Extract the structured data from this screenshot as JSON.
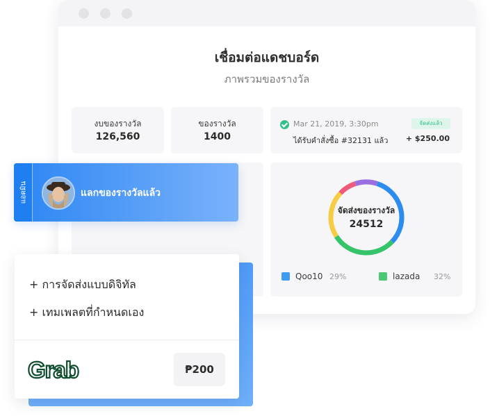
{
  "dashboard": {
    "title": "เชื่อมต่อแดชบอร์ด",
    "subtitle": "ภาพรวมของรางวัล",
    "stats": [
      {
        "label": "งบของรางวัล",
        "value": "126,560"
      },
      {
        "label": "ของรางวัล",
        "value": "1400"
      }
    ],
    "order": {
      "date": "Mar 21, 2019, 3:30pm",
      "status": "จัดส่งแล้ว",
      "text": "ได้รับคำสั่งซื้อ #32131 แล้ว",
      "amount": "+ $250.00",
      "status_color": "#34c08a"
    },
    "delivery": {
      "label": "จัดส่งของรางวัล",
      "value": "24512"
    }
  },
  "chart_data": {
    "type": "pie",
    "title": "",
    "segments": [
      {
        "color": "#2d8cf0",
        "value": 32
      },
      {
        "color": "#36c46a",
        "value": 29
      },
      {
        "color": "#f7cc45",
        "value": 21
      },
      {
        "color": "#ef5a7a",
        "value": 8
      },
      {
        "color": "#9b6ee0",
        "value": 10
      }
    ],
    "legend": [
      {
        "name": "Qoo10",
        "pct": "29%",
        "color": "#3d9bf2"
      },
      {
        "name": "lazada",
        "pct": "32%",
        "color": "#4cc774"
      }
    ]
  },
  "notification": {
    "tab_label": "แอดมิน",
    "text": "แลกของรางวัลแล้ว"
  },
  "promo": {
    "features": [
      "+ การจัดส่งแบบดิจิทัล",
      "+ เทมเพลตที่กำหนดเอง"
    ],
    "brand": "Grab",
    "price": "₱200",
    "brand_color": "#0f4d2e"
  }
}
